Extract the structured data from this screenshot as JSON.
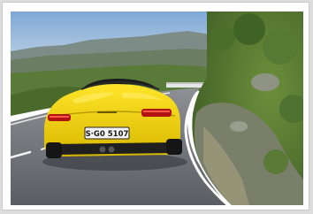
{
  "photo": {
    "subject": "yellow-sports-car",
    "plate_text": "S·G0 5107"
  },
  "colors": {
    "car_body": "#f2d200",
    "road": "#6b6f73",
    "sky": "#8fb6dd",
    "foliage": "#4f7a2e"
  }
}
